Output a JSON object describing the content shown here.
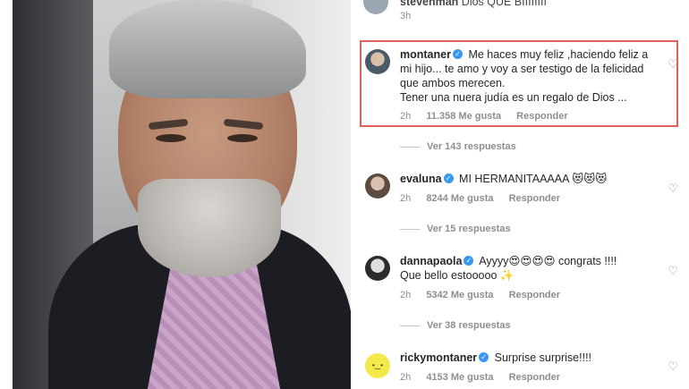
{
  "top_comment": {
    "user": "stevenman",
    "text": "Dios QUE BIIIIIIII",
    "time": "3h"
  },
  "comments": [
    {
      "user": "montaner",
      "verified": true,
      "text": "Me haces muy feliz ,haciendo feliz a mi hijo... te amo y voy a ser testigo de la felicidad que ambos merecen.",
      "text2": "Tener una nuera judía es un regalo de Dios ...",
      "time": "2h",
      "likes": "11.358 Me gusta",
      "reply": "Responder",
      "replies": "Ver 143 respuestas"
    },
    {
      "user": "evaluna",
      "verified": true,
      "text": "MI HERMANITAAAAA 😻😻😻",
      "time": "2h",
      "likes": "8244 Me gusta",
      "reply": "Responder",
      "replies": "Ver 15 respuestas"
    },
    {
      "user": "dannapaola",
      "verified": true,
      "text": "Ayyyy😍😍😍😍 congrats !!!!",
      "text2": "Que bello estooooo ✨",
      "time": "2h",
      "likes": "5342 Me gusta",
      "reply": "Responder",
      "replies": "Ver 38 respuestas"
    },
    {
      "user": "rickymontaner",
      "verified": true,
      "text": "Surprise surprise!!!!",
      "time": "2h",
      "likes": "4153 Me gusta",
      "reply": "Responder"
    }
  ],
  "icons": {
    "like": "heart-outline-icon",
    "verified": "verified-badge-icon"
  },
  "colors": {
    "highlight": "#e0605c",
    "verified": "#3897f0",
    "meta": "#8e8e8e"
  }
}
